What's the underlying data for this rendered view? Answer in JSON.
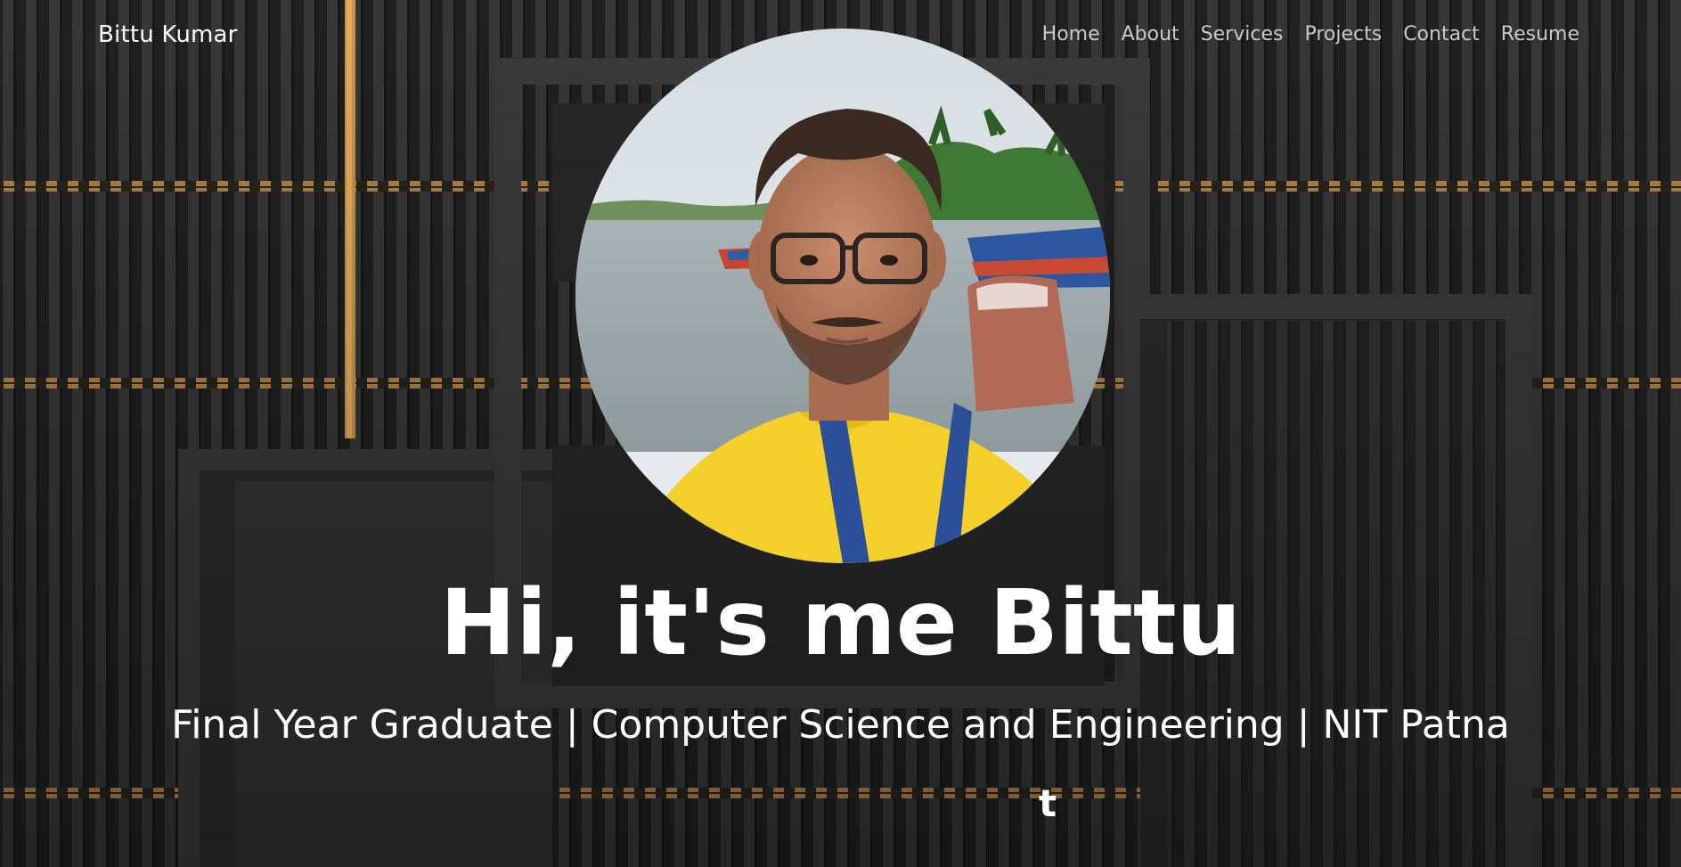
{
  "brand": {
    "name": "Bittu Kumar"
  },
  "nav": {
    "items": [
      {
        "label": "Home"
      },
      {
        "label": "About"
      },
      {
        "label": "Services"
      },
      {
        "label": "Projects"
      },
      {
        "label": "Contact"
      },
      {
        "label": "Resume"
      }
    ]
  },
  "hero": {
    "headline": "Hi, it's me Bittu",
    "subtitle": "Final Year Graduate | Computer Science and Engineering | NIT Patna",
    "typed_text": "t"
  },
  "colors": {
    "background": "#262626",
    "text": "#ffffff",
    "nav_text": "#c9c9c9",
    "accent_gold": "#c89a55",
    "shirt_yellow": "#f4cf2a",
    "lanyard_blue": "#2c4f9a"
  },
  "icons": {
    "profile_photo": "profile-photo",
    "background": "architectural-slat-wall"
  }
}
